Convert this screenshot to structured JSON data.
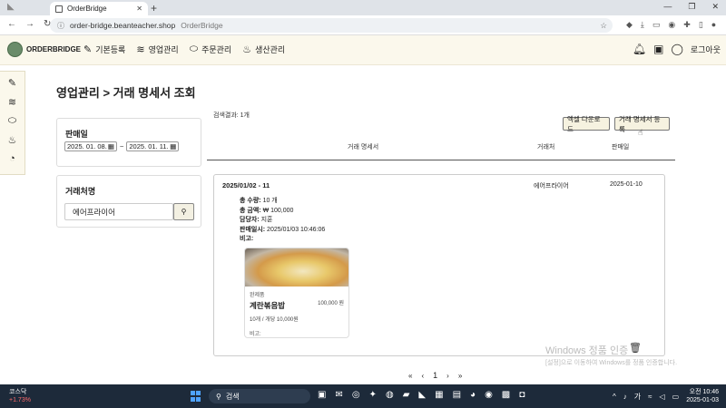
{
  "browser": {
    "tab_title": "OrderBridge",
    "url": "order-bridge.beanteacher.shop",
    "url_page_title": "OrderBridge"
  },
  "header": {
    "brand": "ORDERBRIDGE",
    "nav": [
      "기본등록",
      "영업관리",
      "주문관리",
      "생산관리"
    ],
    "logout": "로그아웃"
  },
  "page": {
    "title": "영업관리 > 거래 명세서 조회"
  },
  "filters": {
    "date_label": "판매일",
    "date_from": "2025. 01. 08.",
    "date_sep": "~",
    "date_to": "2025. 01. 11.",
    "client_label": "거래처명",
    "client_value": "에어프라이어"
  },
  "results": {
    "count_text": "검색결과: 1개",
    "excel_button": "엑셀 다운로드",
    "register_button": "거래 명세서 등록",
    "columns": [
      "거래 명세서",
      "거래처",
      "판매일"
    ]
  },
  "record": {
    "title": "2025/01/02 - 11",
    "client": "에어프라이어",
    "date": "2025-01-10",
    "info": [
      {
        "label": "총 수량:",
        "value": "10 개"
      },
      {
        "label": "총 금액:",
        "value": "₩ 100,000"
      },
      {
        "label": "담당자:",
        "value": "지훈"
      },
      {
        "label": "판매일시:",
        "value": "2025/01/03 10:46:06"
      },
      {
        "label": "비고:",
        "value": ""
      }
    ],
    "product": {
      "category": "완제품",
      "name": "계란볶음밥",
      "price": "100,000 원",
      "qty": "10개 / 개당 10,000원",
      "note": "비고:"
    }
  },
  "watermark": {
    "line1": "Windows 정품 인증",
    "line2": "[설정]으로 이동하여 Windows를 정품 인증합니다."
  },
  "pagination": {
    "first": "«",
    "prev": "‹",
    "current": "1",
    "next": "›",
    "last": "»"
  },
  "taskbar": {
    "stock_name": "코스닥",
    "stock_delta": "+1.73%",
    "search_placeholder": "검색",
    "ime": "가",
    "time": "오전 10:46",
    "date": "2025-01-03"
  }
}
